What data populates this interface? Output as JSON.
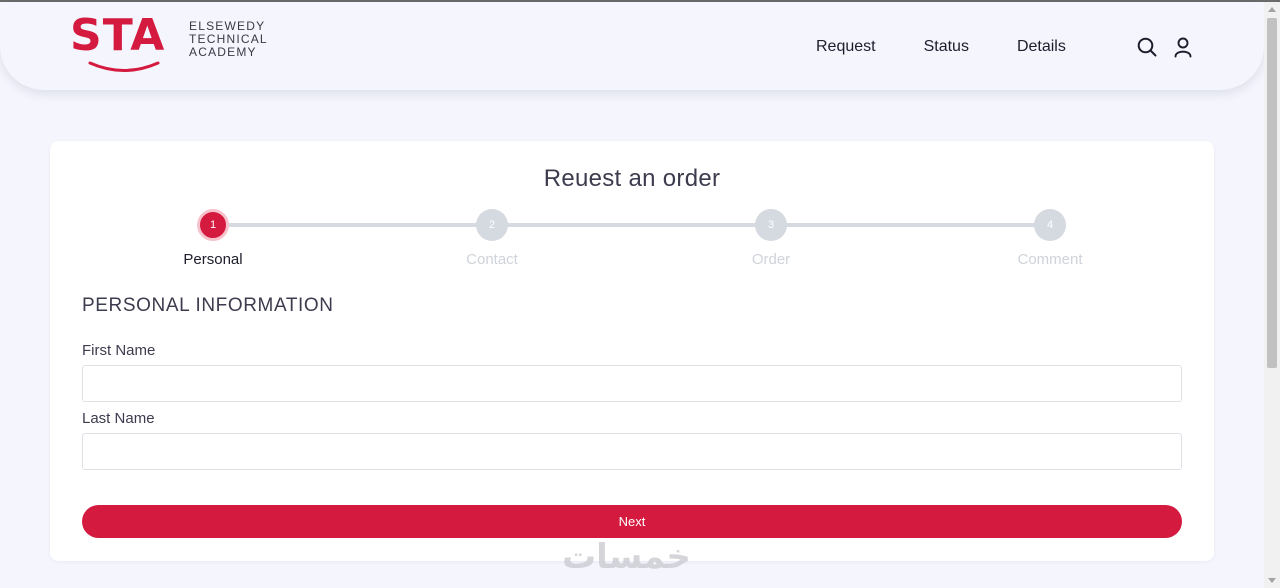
{
  "brand": {
    "logo_text": "STA",
    "subtitle_lines": [
      "ELSEWEDY",
      "TECHNICAL",
      "ACADEMY"
    ],
    "accent_color": "#d41a3e"
  },
  "nav": {
    "links": [
      "Request",
      "Status",
      "Details"
    ],
    "icons": [
      "search-icon",
      "user-icon"
    ]
  },
  "form": {
    "title": "Reuest an order",
    "steps": [
      {
        "number": "1",
        "label": "Personal",
        "active": true
      },
      {
        "number": "2",
        "label": "Contact",
        "active": false
      },
      {
        "number": "3",
        "label": "Order",
        "active": false
      },
      {
        "number": "4",
        "label": "Comment",
        "active": false
      }
    ],
    "section_title": "PERSONAL INFORMATION",
    "fields": [
      {
        "label": "First Name",
        "value": "",
        "placeholder": ""
      },
      {
        "label": "Last Name",
        "value": "",
        "placeholder": ""
      }
    ],
    "next_label": "Next"
  },
  "watermark": "خمسات"
}
